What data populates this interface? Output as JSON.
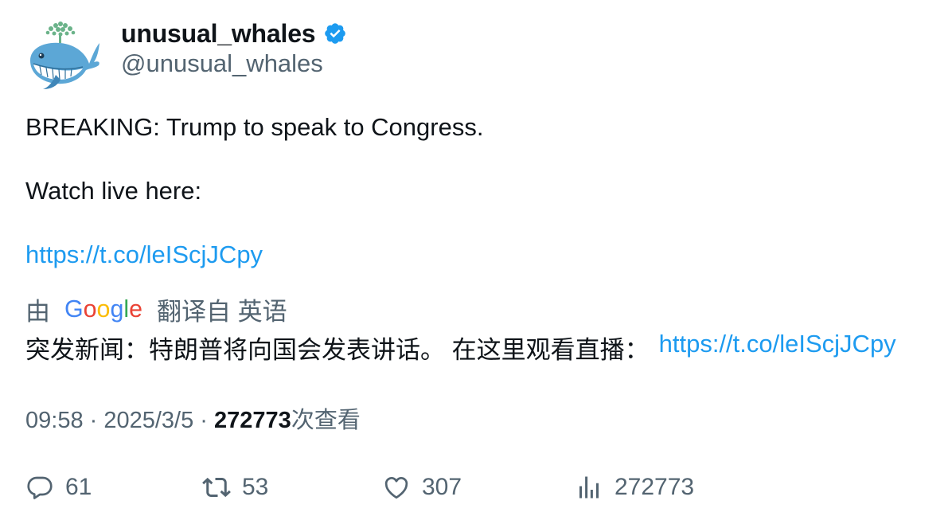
{
  "author": {
    "display_name": "unusual_whales",
    "handle": "@unusual_whales",
    "verified": true
  },
  "tweet": {
    "line1": "BREAKING: Trump to speak to Congress.",
    "line2": "Watch live here:",
    "link": "https://t.co/leIScjJCpy"
  },
  "translation": {
    "prefix": "由",
    "provider_logo": "Google",
    "suffix": "翻译自 英语",
    "text": "突发新闻：特朗普将向国会发表讲话。 在这里观看直播：",
    "link": "https://t.co/leIScjJCpy"
  },
  "meta": {
    "time": "09:58",
    "sep1": " · ",
    "date": "2025/3/5",
    "sep2": " · ",
    "views": "272773",
    "views_suffix": "次查看"
  },
  "actions": {
    "replies": "61",
    "reposts": "53",
    "likes": "307",
    "views": "272773"
  },
  "icons": {
    "reply": "reply-icon",
    "repost": "repost-icon",
    "like": "heart-icon",
    "views": "analytics-icon",
    "verified": "verified-badge-icon"
  },
  "colors": {
    "link": "#1d9bf0",
    "secondary_text": "#536471",
    "verified": "#1d9bf0"
  }
}
